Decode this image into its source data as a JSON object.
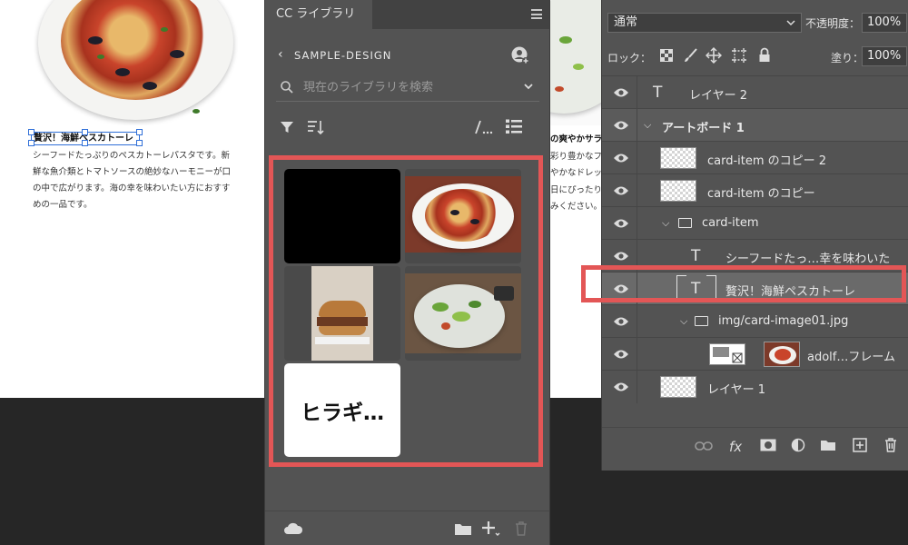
{
  "canvas": {
    "card_left": {
      "title": "贅沢！海鮮ペスカトーレ",
      "body": "シーフードたっぷりのペスカトーレパスタです。新鮮な魚介類とトマトソースの絶妙なハーモニーが口の中で広がります。海の幸を味わいたい方におすすめの一品です。"
    },
    "card_right": {
      "lines": [
        "の爽やかサラ",
        "彩り豊かなフ",
        "やかなドレッ",
        "日にぴったりの",
        "みください。"
      ]
    }
  },
  "cc_panel": {
    "tab_label": "CC ライブラリ",
    "library_name": "SAMPLE-DESIGN",
    "search_placeholder": "現在のライブラリを検索",
    "text_asset_label": "ヒラギ…",
    "assets": [
      "black-swatch",
      "pasta-photo",
      "burger-photo",
      "salad-photo",
      "text-style"
    ]
  },
  "layers_panel": {
    "blend_mode": "通常",
    "opacity_label": "不透明度：",
    "opacity_value": "100%",
    "lock_label": "ロック：",
    "fill_label": "塗り：",
    "fill_value": "100%",
    "layers": [
      {
        "name": "レイヤー 2",
        "kind": "text"
      },
      {
        "name": "アートボード 1",
        "kind": "artboard"
      },
      {
        "name": "card-item のコピー 2",
        "kind": "smart-object"
      },
      {
        "name": "card-item のコピー",
        "kind": "smart-object"
      },
      {
        "name": "card-item",
        "kind": "group"
      },
      {
        "name": "シーフードたっ…幸を味わいた",
        "kind": "text"
      },
      {
        "name": "贅沢！海鮮ペスカトーレ",
        "kind": "text",
        "selected": true
      },
      {
        "name": "img/card-image01.jpg",
        "kind": "group"
      },
      {
        "name": "adolf…フレーム",
        "kind": "frame"
      },
      {
        "name": "レイヤー 1",
        "kind": "pixel"
      }
    ]
  },
  "colors": {
    "highlight": "#e35656",
    "panel_bg": "#535353",
    "selection_blue": "#2f6fd8"
  }
}
